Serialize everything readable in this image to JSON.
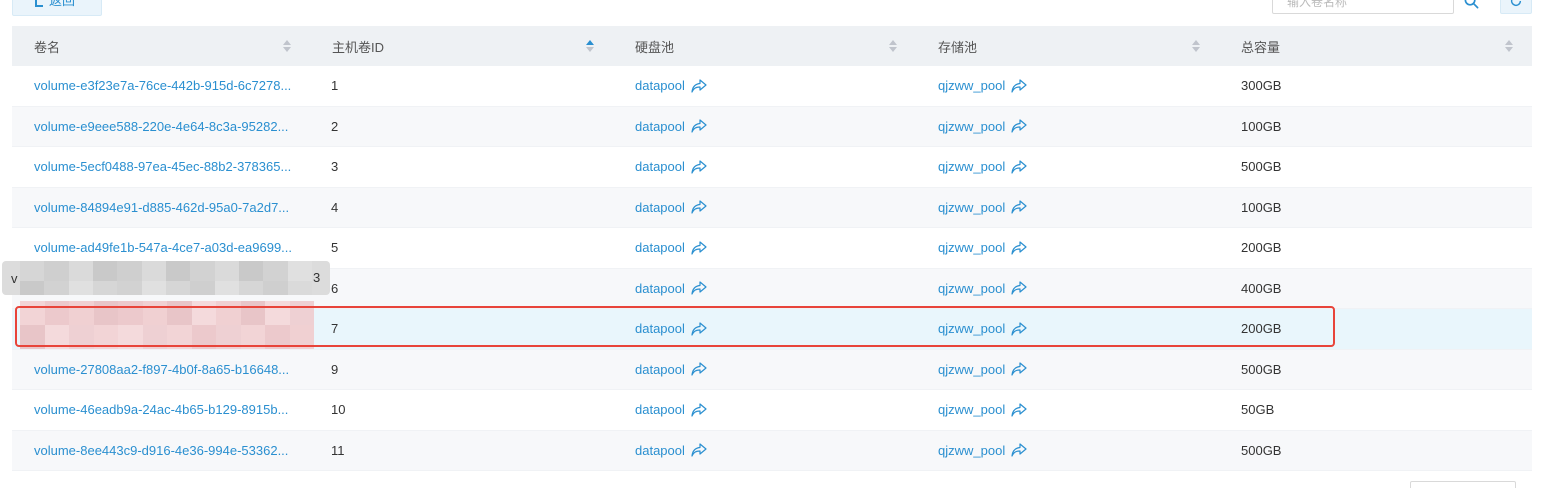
{
  "toolbar": {
    "back_label": "返回",
    "search_placeholder": "输入卷名称"
  },
  "table": {
    "columns": [
      {
        "key": "name",
        "label": "卷名",
        "sort": "none"
      },
      {
        "key": "host_volume_id",
        "label": "主机卷ID",
        "sort": "ascending"
      },
      {
        "key": "disk_pool",
        "label": "硬盘池",
        "sort": "none"
      },
      {
        "key": "storage_pool",
        "label": "存储池",
        "sort": "none"
      },
      {
        "key": "capacity",
        "label": "总容量",
        "sort": "none"
      }
    ],
    "rows": [
      {
        "name": "volume-e3f23e7a-76ce-442b-915d-6c7278...",
        "id": "1",
        "disk_pool": "datapool",
        "storage_pool": "qjzww_pool",
        "capacity": "300GB"
      },
      {
        "name": "volume-e9eee588-220e-4e64-8c3a-95282...",
        "id": "2",
        "disk_pool": "datapool",
        "storage_pool": "qjzww_pool",
        "capacity": "100GB"
      },
      {
        "name": "volume-5ecf0488-97ea-45ec-88b2-378365...",
        "id": "3",
        "disk_pool": "datapool",
        "storage_pool": "qjzww_pool",
        "capacity": "500GB"
      },
      {
        "name": "volume-84894e91-d885-462d-95a0-7a2d7...",
        "id": "4",
        "disk_pool": "datapool",
        "storage_pool": "qjzww_pool",
        "capacity": "100GB"
      },
      {
        "name": "volume-ad49fe1b-547a-4ce7-a03d-ea9699...",
        "id": "5",
        "disk_pool": "datapool",
        "storage_pool": "qjzww_pool",
        "capacity": "200GB"
      },
      {
        "name": "",
        "id": "6",
        "disk_pool": "datapool",
        "storage_pool": "qjzww_pool",
        "capacity": "400GB"
      },
      {
        "name": "",
        "id": "7",
        "disk_pool": "datapool",
        "storage_pool": "qjzww_pool",
        "capacity": "200GB"
      },
      {
        "name": "volume-27808aa2-f897-4b0f-8a65-b16648...",
        "id": "9",
        "disk_pool": "datapool",
        "storage_pool": "qjzww_pool",
        "capacity": "500GB"
      },
      {
        "name": "volume-46eadb9a-24ac-4b65-b129-8915b...",
        "id": "10",
        "disk_pool": "datapool",
        "storage_pool": "qjzww_pool",
        "capacity": "50GB"
      },
      {
        "name": "volume-8ee443c9-d916-4e36-994e-53362...",
        "id": "11",
        "disk_pool": "datapool",
        "storage_pool": "qjzww_pool",
        "capacity": "500GB"
      }
    ]
  },
  "tooltip": {
    "start_char": "v",
    "end_char": "3"
  },
  "colors": {
    "link": "#2a8fd0",
    "header_bg": "#eef1f4",
    "highlight_row_bg": "#e9f6fc",
    "highlight_border": "#e8443a",
    "sort_active": "#2a8fd0",
    "sort_inactive": "#c0c4cc"
  },
  "icons": {
    "back": "chevron-left-icon",
    "search": "search-icon",
    "refresh": "refresh-icon",
    "share": "share-arrow-icon",
    "sort": "sort-caret-icon"
  }
}
